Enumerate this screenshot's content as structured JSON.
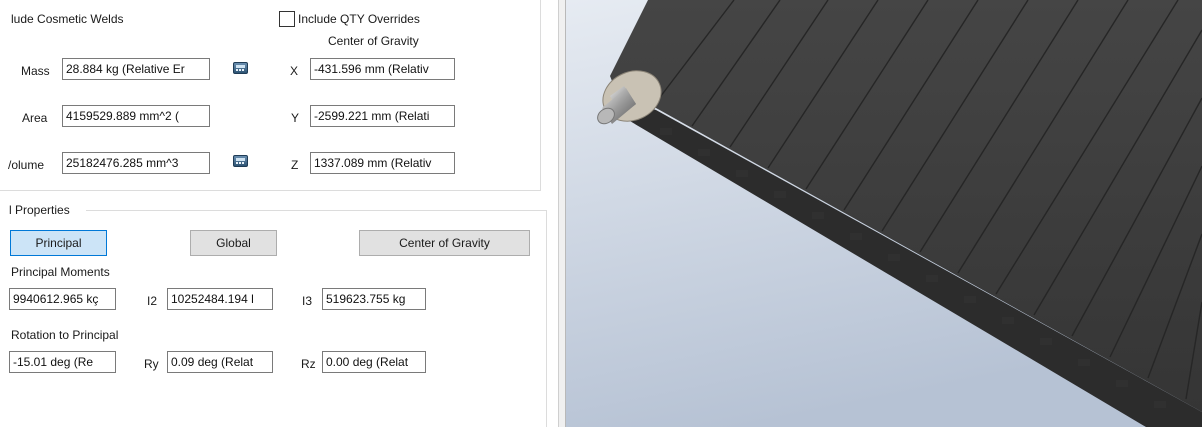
{
  "physical": {
    "include_cosmetic_welds_label": "lude Cosmetic Welds",
    "include_qty_overrides_label": "Include QTY Overrides",
    "include_qty_overrides_checked": false,
    "center_of_gravity_heading": "Center of Gravity",
    "mass_label": "Mass",
    "mass_value": "28.884 kg (Relative Er",
    "area_label": "Area",
    "area_value": "4159529.889 mm^2 (",
    "volume_label": "/olume",
    "volume_value": "25182476.285 mm^3",
    "x_label": "X",
    "x_value": "-431.596 mm (Relativ",
    "y_label": "Y",
    "y_value": "-2599.221 mm (Relati",
    "z_label": "Z",
    "z_value": "1337.089 mm (Relativ"
  },
  "inertial": {
    "group_title": "l Properties",
    "buttons": [
      "Principal",
      "Global",
      "Center of Gravity"
    ],
    "active_button": "Principal",
    "principal_moments_label": "Principal Moments",
    "i1_value": "9940612.965 kç",
    "i2_label": "I2",
    "i2_value": "10252484.194 l",
    "i3_label": "I3",
    "i3_value": "519623.755 kg",
    "rotation_label": "Rotation to Principal",
    "rx_value": "-15.01 deg (Re",
    "ry_label": "Ry",
    "ry_value": "0.09 deg (Relat",
    "rz_label": "Rz",
    "rz_value": "0.00 deg (Relat"
  },
  "viewport": {
    "background_top": "#e6ebf2",
    "background_bottom": "#b6c2d4",
    "belt_color": "#3a3a3a",
    "model": "conveyor-belt-with-roller-shaft"
  }
}
